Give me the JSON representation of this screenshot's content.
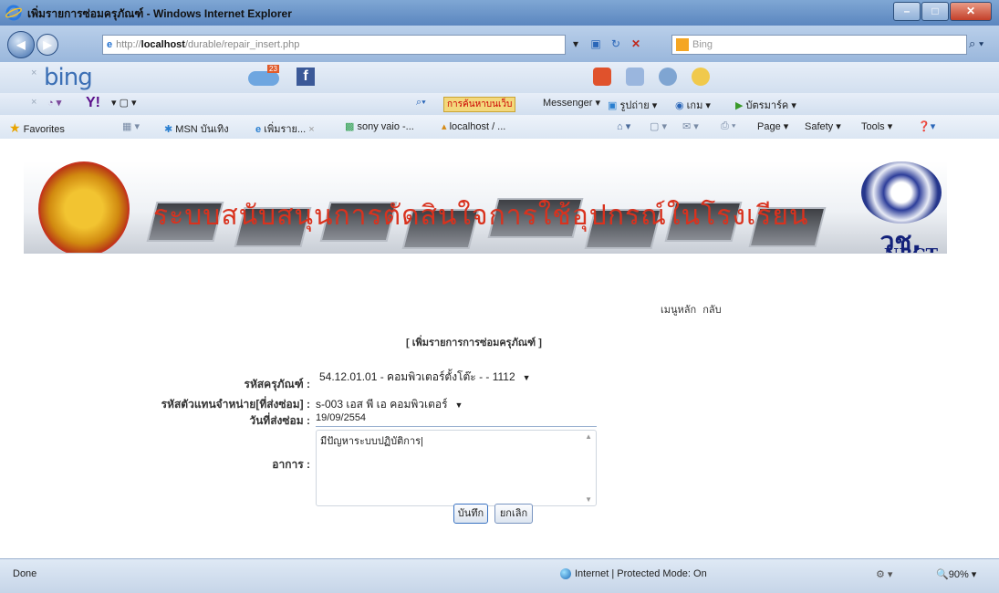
{
  "window": {
    "title": "เพิ่มรายการซ่อมครุภัณฑ์ - Windows Internet Explorer"
  },
  "address": {
    "prefix": "http://",
    "host": "localhost",
    "path": "/durable/repair_insert.php",
    "search_placeholder": "Bing"
  },
  "toolbar1": {
    "brand": "bing",
    "badge_count": "23"
  },
  "toolbar2": {
    "search_button": "การค้นหาบนเว็บ",
    "messenger": "Messenger",
    "item1": "รูปถ่าย",
    "item2": "เกม",
    "item3": "บัตรมาร์ค"
  },
  "toolbar3": {
    "favorites": "Favorites",
    "tab1": "MSN บันเทิง",
    "tab2": "เพิ่มราย...",
    "tab3": "sony vaio -...",
    "tab4": "localhost / ...",
    "page": "Page",
    "safety": "Safety",
    "tools": "Tools"
  },
  "banner": {
    "title": "ระบบสนับสนุนการตัดสินใจการใช้อุปกรณ์ในโรงเรียน",
    "logo_right_th": "วช.",
    "logo_right_en": "NRCT"
  },
  "menu": {
    "main": "เมนูหลัก",
    "back": "กลับ"
  },
  "form": {
    "title": "[ เพิ่มรายการการซ่อมครุภัณฑ์ ]",
    "asset_label": "รหัสครุภัณฑ์ :",
    "asset_value": "54.12.01.01 - คอมพิวเตอร์ตั้งโต๊ะ - - 1112",
    "vendor_label": "รหัสตัวแทนจำหน่าย[ที่ส่งซ่อม] :",
    "vendor_value": "s-003 เอส พี เอ คอมพิวเตอร์",
    "date_label": "วันที่ส่งซ่อม :",
    "date_value": "19/09/2554",
    "symptom_label": "อาการ :",
    "symptom_value": "มีปัญหาระบบปฏิบัติการ|",
    "save_button": "บันทึก",
    "cancel_button": "ยกเลิก"
  },
  "statusbar": {
    "left": "Done",
    "zone": "Internet | Protected Mode: On",
    "zoom": "90%"
  }
}
